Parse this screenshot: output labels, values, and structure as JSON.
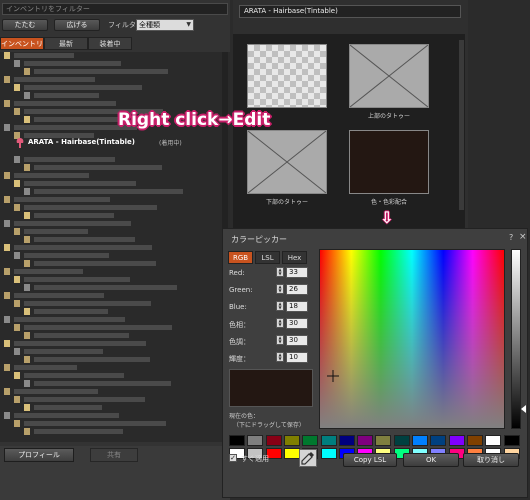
{
  "inventory": {
    "filter_placeholder": "インベントリをフィルター",
    "collapse_label": "たたむ",
    "expand_label": "広げる",
    "filter_label": "フィルタ",
    "filter_value": "全種類",
    "tabs": [
      {
        "label": "インベントリ",
        "active": true
      },
      {
        "label": "最新",
        "active": false
      },
      {
        "label": "装着中",
        "active": false
      }
    ],
    "highlighted_item": {
      "name": "ARATA - Hairbase(Tintable)",
      "status": "(着用中)"
    },
    "profile_button": "プロフィール",
    "share_button": "共有"
  },
  "texture_panel": {
    "title": "ARATA - Hairbase(Tintable)",
    "slots": [
      {
        "label": "",
        "kind": "checker"
      },
      {
        "label": "上部のタトゥー",
        "kind": "empty"
      },
      {
        "label": "下部のタトゥー",
        "kind": "empty"
      },
      {
        "label": "色・色彩配合",
        "kind": "color",
        "color": "#231712"
      }
    ]
  },
  "annotation": {
    "text": "Right click→Edit",
    "arrow": "⇩",
    "color": "#c81e69"
  },
  "color_picker": {
    "title": "カラーピッカー",
    "help_icon": "?",
    "close_icon": "×",
    "tabs": [
      {
        "label": "RGB",
        "active": true
      },
      {
        "label": "LSL",
        "active": false
      },
      {
        "label": "Hex",
        "active": false
      }
    ],
    "fields": [
      {
        "label": "Red:",
        "value": "33"
      },
      {
        "label": "Green:",
        "value": "26"
      },
      {
        "label": "Blue:",
        "value": "18"
      },
      {
        "label": "色相：",
        "value": "30"
      },
      {
        "label": "色調：",
        "value": "30"
      },
      {
        "label": "輝度：",
        "value": "10"
      }
    ],
    "current_color": "#231712",
    "current_color_label": "現在の色：",
    "drag_hint": "（下にドラッグして保存）",
    "palette_row1": [
      "#000000",
      "#7f7f7f",
      "#880015",
      "#7f7f00",
      "#00782e",
      "#007f7f",
      "#00007f",
      "#7f007f",
      "#7f7f3f",
      "#004040",
      "#0080ff",
      "#004080",
      "#8000ff",
      "#804000",
      "#ffffff",
      "#000000"
    ],
    "palette_row2": [
      "#ffffff",
      "#c3c3c3",
      "#ff0000",
      "#ffff00",
      "#00ff00",
      "#00ffff",
      "#0000ff",
      "#ff00ff",
      "#ffff80",
      "#00ff80",
      "#80ffff",
      "#8080ff",
      "#ff0080",
      "#ff8040",
      "#ffffff",
      "#ffd5a0"
    ],
    "apply_now_label": "すぐ適用",
    "copy_lsl_label": "Copy LSL",
    "ok_label": "OK",
    "cancel_label": "取り消し"
  }
}
